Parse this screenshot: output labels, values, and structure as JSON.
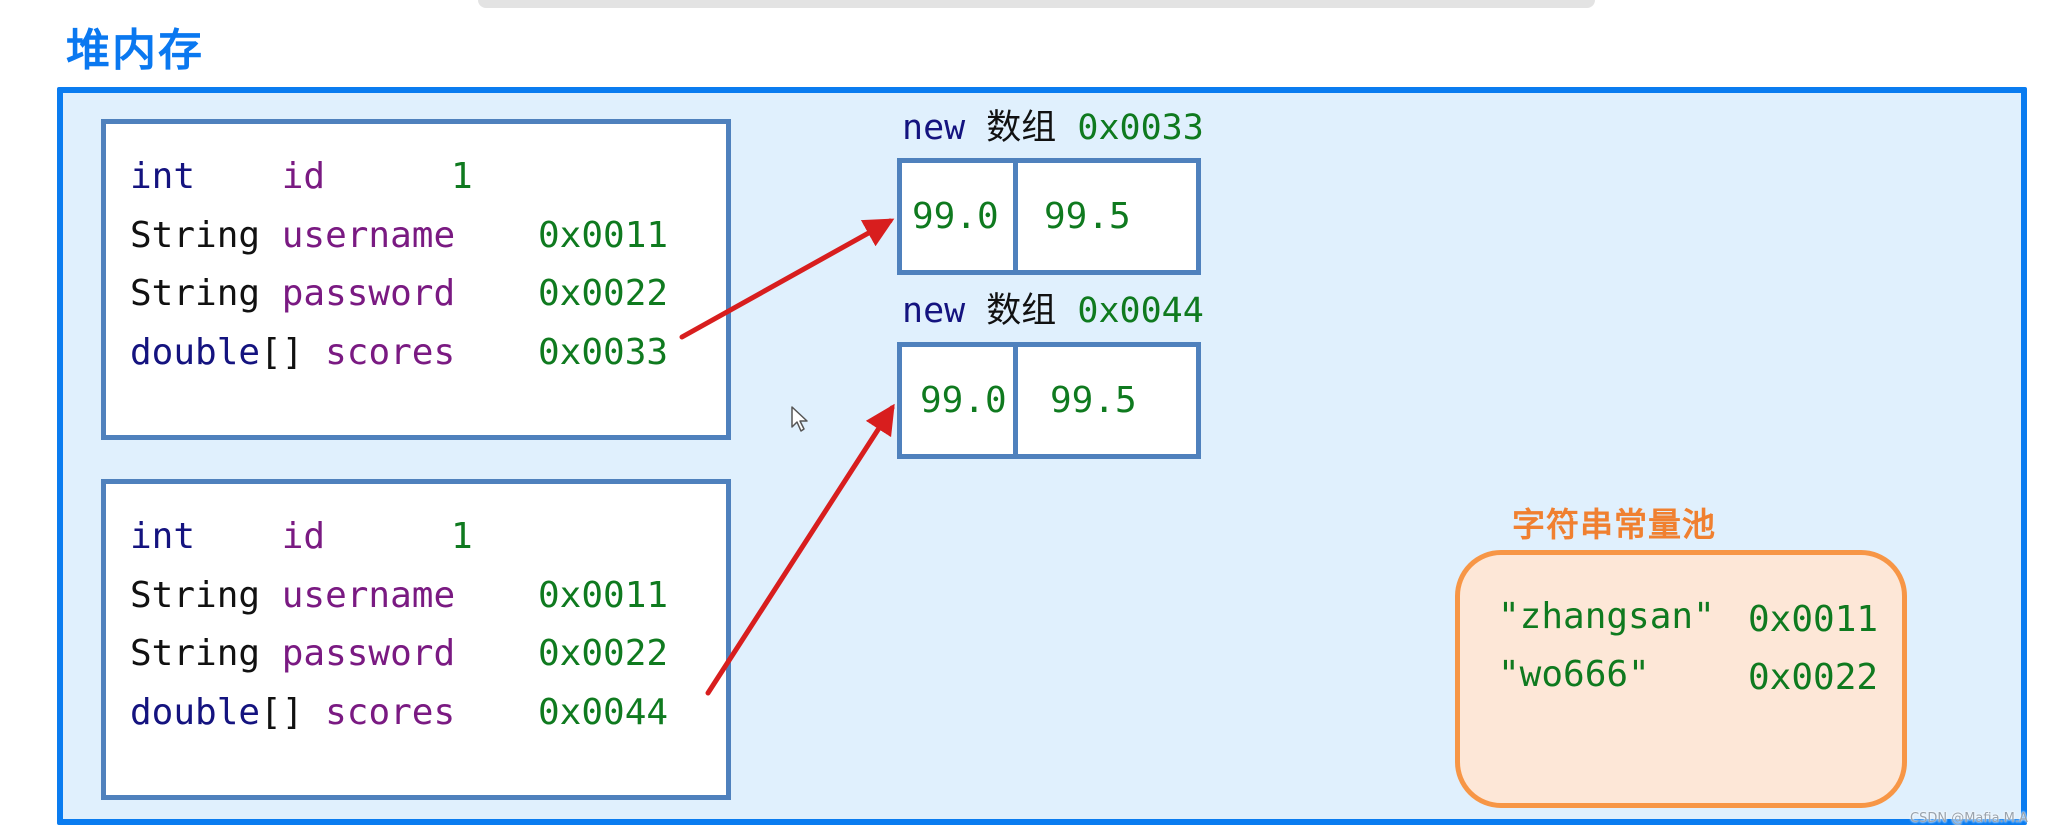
{
  "title": "堆内存",
  "objects": [
    {
      "fields": [
        {
          "type": "int",
          "name": "id",
          "value": "1"
        },
        {
          "type": "String",
          "name": "username",
          "value": "0x0011"
        },
        {
          "type": "String",
          "name": "password",
          "value": "0x0022"
        },
        {
          "type": "double",
          "type_suffix": "[]",
          "name": "scores",
          "value": "0x0033"
        }
      ]
    },
    {
      "fields": [
        {
          "type": "int",
          "name": "id",
          "value": "1"
        },
        {
          "type": "String",
          "name": "username",
          "value": "0x0011"
        },
        {
          "type": "String",
          "name": "password",
          "value": "0x0022"
        },
        {
          "type": "double",
          "type_suffix": "[]",
          "name": "scores",
          "value": "0x0044"
        }
      ]
    }
  ],
  "arrays": [
    {
      "keyword": "new",
      "label": "数组",
      "address": "0x0033",
      "values": [
        "99.0",
        "99.5"
      ]
    },
    {
      "keyword": "new",
      "label": "数组",
      "address": "0x0044",
      "values": [
        "99.0",
        "99.5"
      ]
    }
  ],
  "string_pool": {
    "label": "字符串常量池",
    "entries": [
      {
        "literal": "\"zhangsan\"",
        "address": "0x0011"
      },
      {
        "literal": "\"wo666\"",
        "address": "0x0022"
      }
    ]
  },
  "references": [
    {
      "from": "objects.0.scores",
      "to": "arrays.0"
    },
    {
      "from": "objects.1.scores",
      "to": "arrays.1"
    }
  ],
  "colors": {
    "title": "#0a78f0",
    "heap_border": "#0a7cf0",
    "heap_fill": "#e0f0fd",
    "box_border": "#4f81bd",
    "keyword": "#14137f",
    "field_name": "#7a1a82",
    "value": "#0f7a1f",
    "arrow": "#d81e1e",
    "pool_label": "#f08030",
    "pool_border": "#f79646",
    "pool_fill": "#fde7d7"
  },
  "watermark": "CSDN @Mafia.M.A"
}
